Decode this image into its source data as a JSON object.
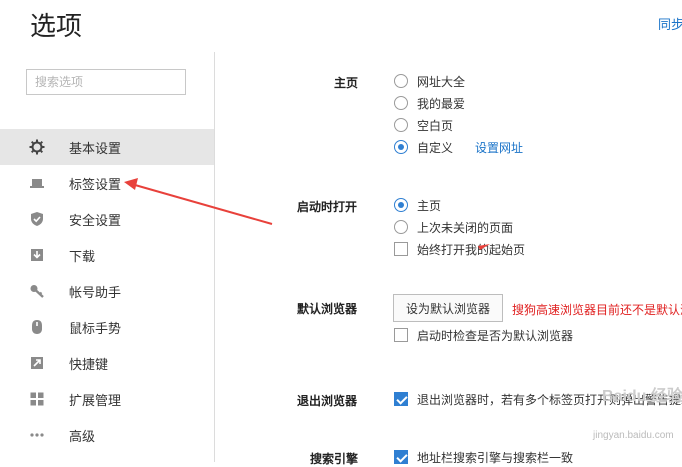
{
  "header": {
    "title": "选项",
    "sync_label": "同步"
  },
  "sidebar": {
    "search_placeholder": "搜索选项",
    "items": [
      {
        "label": "基本设置",
        "icon": "gear-icon",
        "active": true
      },
      {
        "label": "标签设置",
        "icon": "tab-icon"
      },
      {
        "label": "安全设置",
        "icon": "shield-check-icon"
      },
      {
        "label": "下载",
        "icon": "download-icon"
      },
      {
        "label": "帐号助手",
        "icon": "key-icon"
      },
      {
        "label": "鼠标手势",
        "icon": "mouse-icon"
      },
      {
        "label": "快捷键",
        "icon": "shortcut-arrow-icon"
      },
      {
        "label": "扩展管理",
        "icon": "extensions-grid-icon"
      },
      {
        "label": "高级",
        "icon": "more-dots-icon"
      }
    ]
  },
  "homepage": {
    "label": "主页",
    "options": [
      "网址大全",
      "我的最爱",
      "空白页",
      "自定义"
    ],
    "selected": "自定义",
    "set_url_link": "设置网址"
  },
  "startup": {
    "label": "启动时打开",
    "options": [
      "主页",
      "上次未关闭的页面"
    ],
    "selected": "主页",
    "always_open_start": {
      "label": "始终打开我的起始页",
      "checked": false
    }
  },
  "default_browser": {
    "label": "默认浏览器",
    "button": "设为默认浏览器",
    "warning": "搜狗高速浏览器目前还不是默认浏",
    "check_on_start": {
      "label": "启动时检查是否为默认浏览器",
      "checked": false
    }
  },
  "exit_browser": {
    "label": "退出浏览器",
    "option": {
      "label": "退出浏览器时，若有多个标签页打开则弹出警告提示",
      "checked": true
    }
  },
  "search_engine": {
    "label": "搜索引擎",
    "option": {
      "label": "地址栏搜索引擎与搜索栏一致",
      "checked": true
    }
  },
  "watermark": {
    "text": "Baidu 经验",
    "url": "jingyan.baidu.com"
  },
  "colors": {
    "accent": "#2f7fd2",
    "link": "#1a73c8",
    "warning": "#e02020",
    "annotation_arrow": "#e8413b"
  }
}
